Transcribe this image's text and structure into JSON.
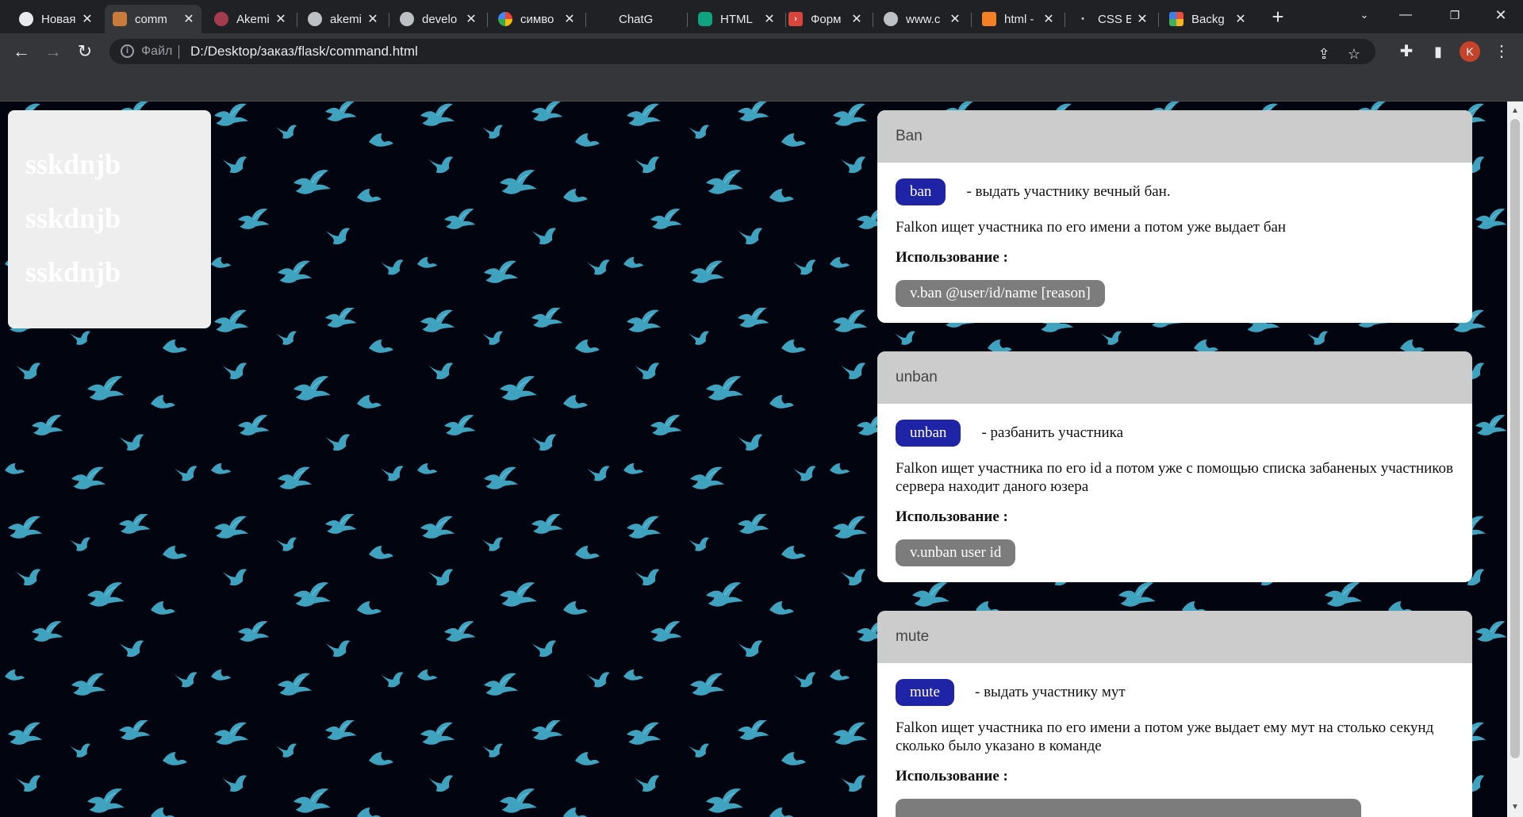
{
  "tabs": [
    {
      "label": "Новая",
      "favicon": "chrome-icon"
    },
    {
      "label": "comm",
      "favicon": "page-favicon",
      "active": true
    },
    {
      "label": "Akemi",
      "favicon": "page-favicon"
    },
    {
      "label": "akemi",
      "favicon": "globe-icon"
    },
    {
      "label": "develo",
      "favicon": "globe-icon"
    },
    {
      "label": "симво",
      "favicon": "google-icon"
    },
    {
      "label": "ChatG",
      "favicon": "none"
    },
    {
      "label": "HTML",
      "favicon": "chatgpt-icon"
    },
    {
      "label": "Форм",
      "favicon": "page-favicon"
    },
    {
      "label": "www.c",
      "favicon": "globe-icon"
    },
    {
      "label": "html -",
      "favicon": "stackoverflow-icon"
    },
    {
      "label": "CSS B",
      "favicon": "dot-icon"
    },
    {
      "label": "Backg",
      "favicon": "page-favicon"
    }
  ],
  "address": {
    "scheme_label": "Файл",
    "url": "D:/Desktop/заказ/flask/command.html"
  },
  "profile_initial": "K",
  "sidebar": {
    "items": [
      "sskdnjb",
      "sskdnjb",
      "sskdnjb"
    ]
  },
  "commands": [
    {
      "header": "Ban",
      "name": "ban",
      "short": "- выдать участнику вечный бан.",
      "description": "Falkon ищет участника по его имени а потом уже выдает бан",
      "usage_label": "Использование :",
      "usage": "v.ban @user/id/name [reason]"
    },
    {
      "header": "unban",
      "name": "unban",
      "short": "- разбанить участника",
      "description": "Falkon ищет участника по его id а потом уже с помощью списка забаненых участников сервера находит даного юзера",
      "usage_label": "Использование :",
      "usage": "v.unban user id"
    },
    {
      "header": "mute",
      "name": "mute",
      "short": "- выдать участнику мут",
      "description": "Falkon ищет участника по его имени а потом уже выдает ему мут на столько секунд сколько было указано в команде",
      "usage_label": "Использование :",
      "usage": ""
    }
  ],
  "colors": {
    "page_bg": "#02050f",
    "bird": "#3fa3c0",
    "pill": "#1f23a6",
    "code_pill": "#7c7c7c",
    "card_header": "#cccccc"
  }
}
